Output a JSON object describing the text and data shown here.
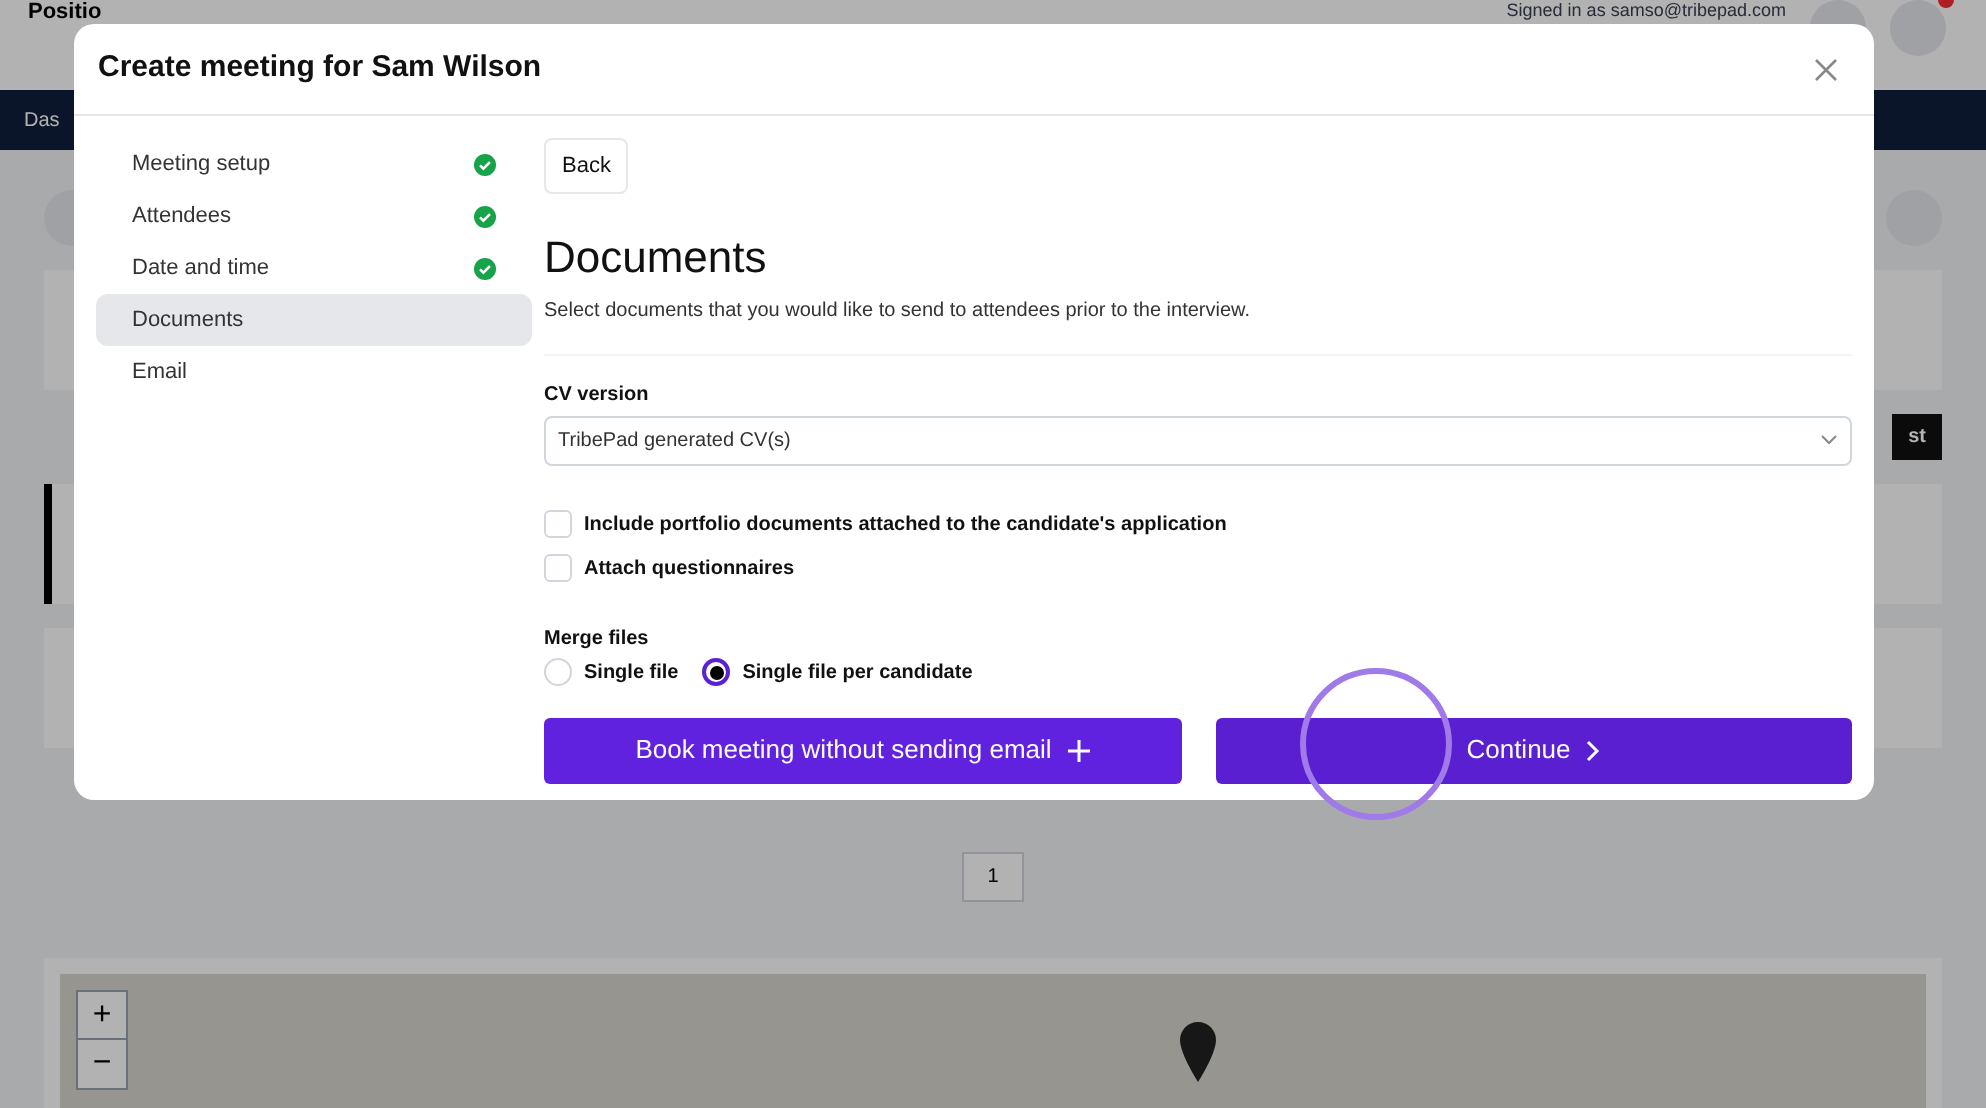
{
  "background": {
    "logo": "Positio",
    "signed_in": "Signed in as samso@tribepad.com",
    "nav_item": "Das",
    "action_button": "st",
    "pagination": "1",
    "map_zoom": [
      "+",
      "−"
    ]
  },
  "modal": {
    "title": "Create meeting for Sam Wilson",
    "steps": [
      {
        "label": "Meeting setup",
        "completed": true,
        "selected": false
      },
      {
        "label": "Attendees",
        "completed": true,
        "selected": false
      },
      {
        "label": "Date and time",
        "completed": true,
        "selected": false
      },
      {
        "label": "Documents",
        "completed": false,
        "selected": true
      },
      {
        "label": "Email",
        "completed": false,
        "selected": false
      }
    ],
    "back": "Back",
    "heading": "Documents",
    "description": "Select documents that you would like to send to attendees prior to the interview.",
    "cv_version": {
      "label": "CV version",
      "value": "TribePad generated CV(s)"
    },
    "options": [
      {
        "label": "Include portfolio documents attached to the candidate's application",
        "checked": false
      },
      {
        "label": "Attach questionnaires",
        "checked": false
      }
    ],
    "merge": {
      "label": "Merge files",
      "choices": [
        {
          "label": "Single file",
          "selected": false
        },
        {
          "label": "Single file per candidate",
          "selected": true
        }
      ]
    },
    "buttons": [
      {
        "label": "Book meeting without sending email",
        "kind": "plus"
      },
      {
        "label": "Continue",
        "kind": "next"
      }
    ]
  }
}
